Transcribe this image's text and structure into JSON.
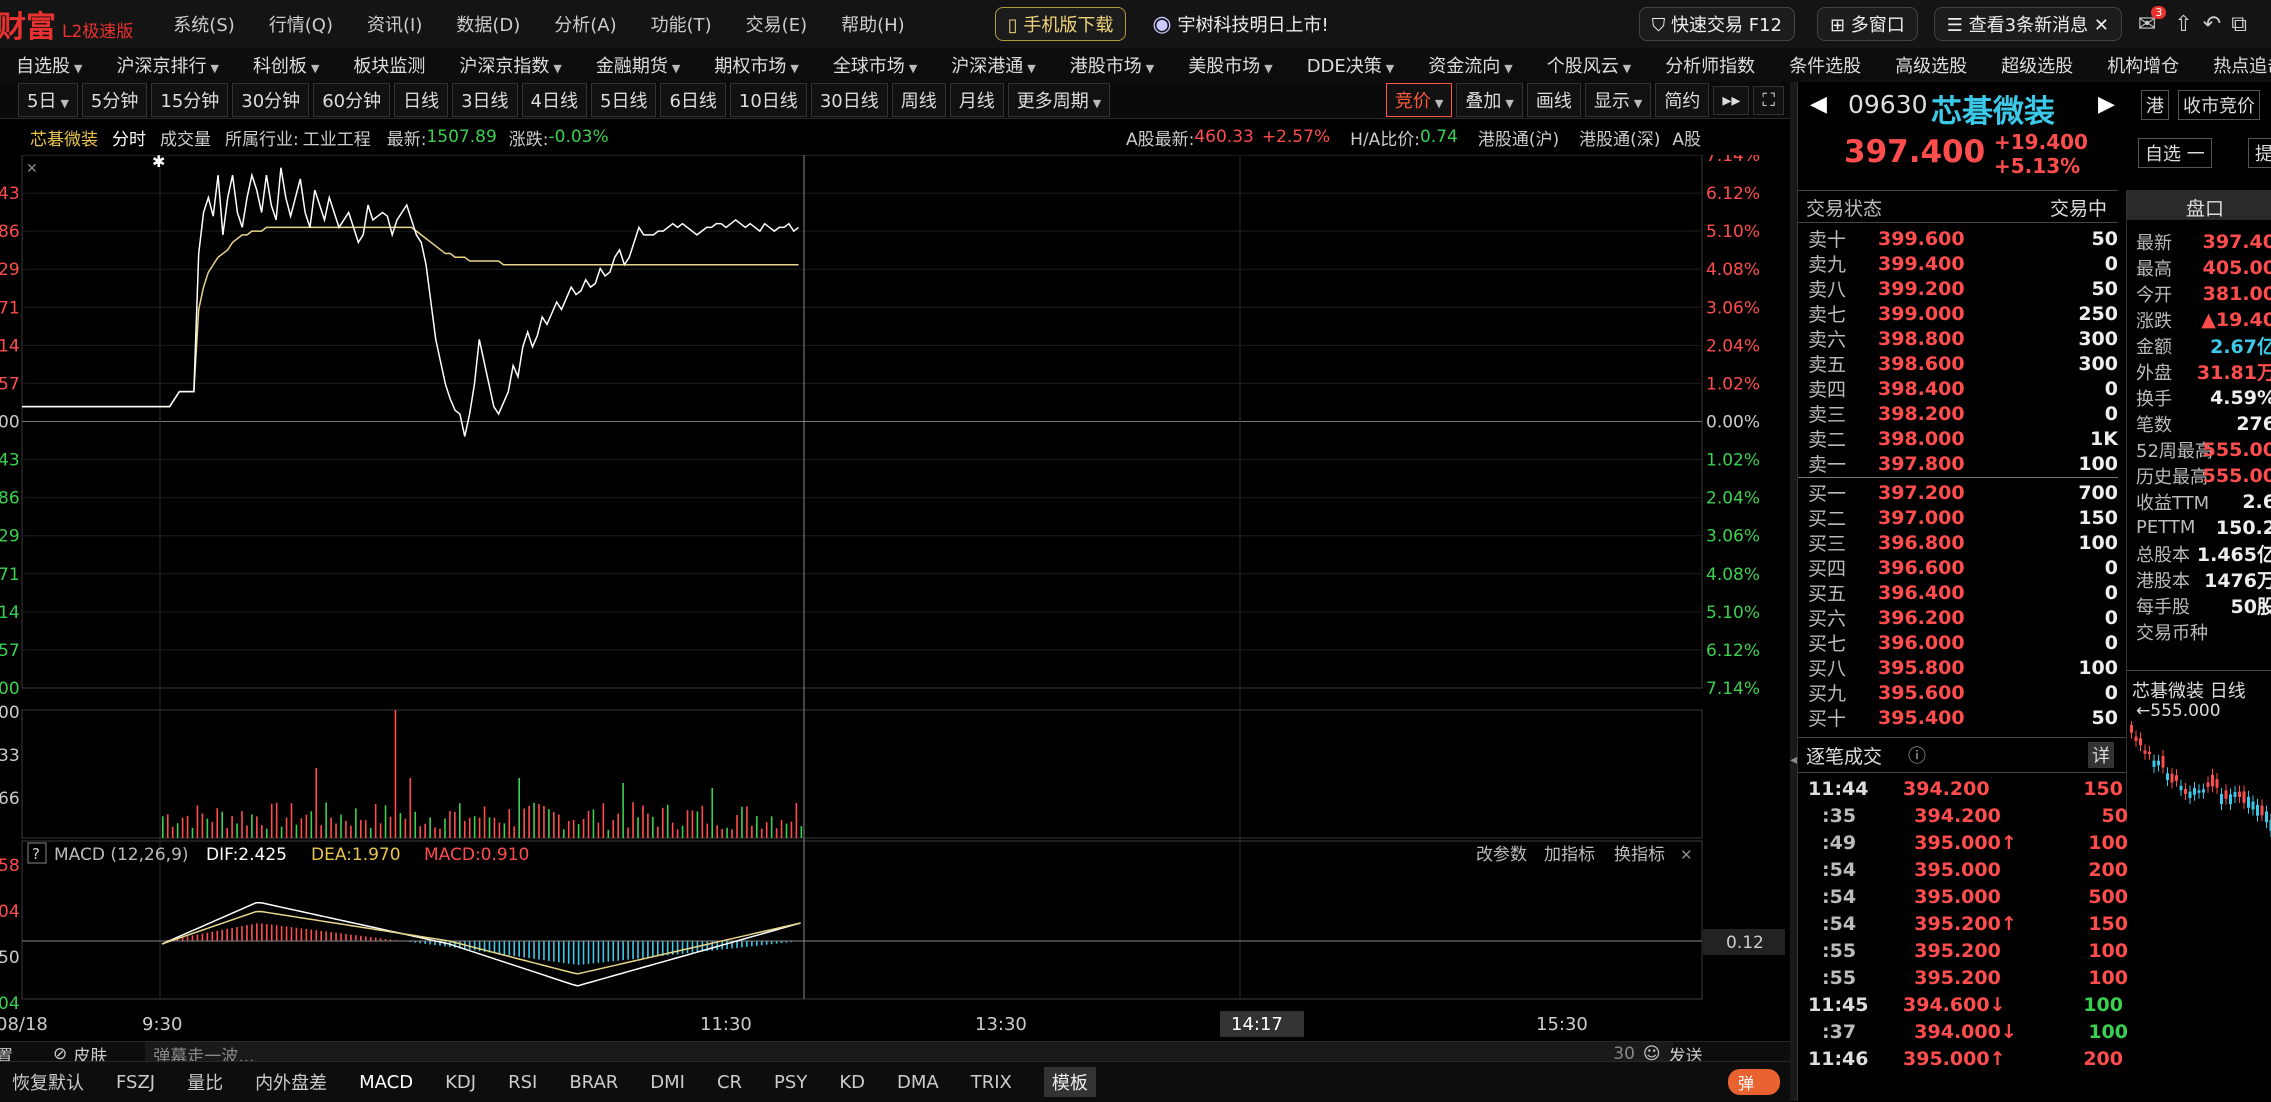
{
  "app": {
    "brand": "财富",
    "edition": "L2极速版"
  },
  "sys_menu": [
    "系统(S)",
    "行情(Q)",
    "资讯(I)",
    "数据(D)",
    "分析(A)",
    "功能(T)",
    "交易(E)",
    "帮助(H)"
  ],
  "titlebar": {
    "mobile": "手机版下载",
    "promo": "宇树科技明日上市!",
    "quick_trade": "快速交易 F12",
    "multi_window": "多窗口",
    "news": "查看3条新消息",
    "badge": "3"
  },
  "menu": [
    "自选股",
    "沪深京排行",
    "科创板",
    "板块监测",
    "沪深京指数",
    "金融期货",
    "期权市场",
    "全球市场",
    "沪深港通",
    "港股市场",
    "美股市场",
    "DDE决策",
    "资金流向",
    "个股风云",
    "分析师指数",
    "条件选股",
    "高级选股",
    "超级选股",
    "机构增仓",
    "热点追击"
  ],
  "periods": [
    "5日",
    "5分钟",
    "15分钟",
    "30分钟",
    "60分钟",
    "日线",
    "3日线",
    "4日线",
    "5日线",
    "6日线",
    "10日线",
    "30日线",
    "周线",
    "月线",
    "更多周期"
  ],
  "period_right": [
    "竞价",
    "叠加",
    "画线",
    "显示",
    "简约"
  ],
  "info": {
    "name": "芯碁微装",
    "mode": "分时",
    "vol": "成交量",
    "industry_label": "所属行业:",
    "industry": "工业工程",
    "latest_label": "最新:",
    "latest": "1507.89",
    "chg_label": "涨跌:",
    "chg": "-0.03%",
    "a_label": "A股最新:",
    "a_price": "460.33",
    "a_chg": "+2.57%",
    "ha_label": "H/A比价:",
    "ha": "0.74",
    "hk1": "港股通(沪)",
    "hk2": "港股通(深)",
    "ashare": "A股"
  },
  "chart_data": [
    {
      "type": "line",
      "name": "intraday",
      "y_left_labels": [
        "43",
        "86",
        "29",
        "71",
        "14",
        "57",
        "00",
        "43",
        "86",
        "29",
        "71",
        "14",
        "57",
        "00"
      ],
      "y_right_labels": [
        "7.14%",
        "6.12%",
        "5.10%",
        "4.08%",
        "3.06%",
        "2.04%",
        "1.02%",
        "0.00%",
        "1.02%",
        "2.04%",
        "3.06%",
        "4.08%",
        "5.10%",
        "6.12%",
        "7.14%"
      ],
      "x_labels": [
        "08/18",
        "9:30",
        "11:30",
        "13:30",
        "14:17",
        "15:30"
      ],
      "ylim": [
        -7.14,
        7.14
      ],
      "x": [
        0,
        2,
        4,
        6,
        7,
        8,
        9,
        10,
        11,
        12,
        13,
        14,
        15,
        16,
        17,
        18,
        19,
        20,
        21,
        22,
        23,
        24,
        25,
        26,
        27,
        28,
        29,
        30,
        31,
        32,
        33,
        34,
        35,
        36,
        37,
        38,
        39,
        40,
        41,
        42,
        43,
        44,
        45,
        46,
        47,
        48,
        49,
        50,
        51,
        52,
        53,
        54,
        55,
        56,
        57,
        58,
        59,
        60,
        61,
        62,
        63,
        64,
        65,
        66,
        67,
        68,
        69,
        70,
        71,
        72,
        73,
        74,
        75,
        76,
        77,
        78,
        79,
        80,
        81,
        82,
        83,
        84,
        85,
        86,
        87,
        88,
        89,
        90,
        91,
        92,
        93,
        94,
        95,
        96,
        97,
        98,
        99,
        100,
        101,
        102,
        103,
        104,
        105,
        106,
        107,
        108,
        109,
        110,
        111,
        112,
        113,
        114,
        115,
        116,
        117,
        118,
        119,
        120,
        121,
        122,
        123,
        124,
        125,
        126,
        127,
        128,
        129,
        130,
        131,
        132
      ],
      "price": [
        0.4,
        0.4,
        0.8,
        0.8,
        0.8,
        4.5,
        5.6,
        6.0,
        5.5,
        6.6,
        5.0,
        6.0,
        6.6,
        5.6,
        5.2,
        6.0,
        6.6,
        6.2,
        5.6,
        6.6,
        5.8,
        5.4,
        6.8,
        6.0,
        5.5,
        6.0,
        6.5,
        5.6,
        5.2,
        6.2,
        5.8,
        5.4,
        6.0,
        5.6,
        5.2,
        5.4,
        5.6,
        5.2,
        4.8,
        5.0,
        5.8,
        5.4,
        5.5,
        5.6,
        5.5,
        5.0,
        5.4,
        5.6,
        5.8,
        5.4,
        5.0,
        4.8,
        4.2,
        3.2,
        2.2,
        1.6,
        1.0,
        0.6,
        0.3,
        0.2,
        -0.4,
        0.2,
        1.0,
        2.2,
        1.6,
        1.0,
        0.4,
        0.2,
        0.5,
        0.8,
        1.5,
        1.2,
        2.0,
        2.4,
        2.0,
        2.3,
        2.8,
        2.6,
        2.9,
        3.2,
        3.0,
        3.3,
        3.6,
        3.4,
        3.5,
        3.8,
        3.6,
        3.7,
        4.1,
        3.9,
        4.0,
        4.4,
        4.6,
        4.2,
        4.4,
        4.8,
        5.2,
        5.0,
        5.0,
        5.0,
        5.1,
        5.1,
        5.2,
        5.3,
        5.2,
        5.3,
        5.2,
        5.1,
        5.0,
        5.1,
        5.2,
        5.2,
        5.3,
        5.3,
        5.2,
        5.3,
        5.4,
        5.3,
        5.2,
        5.3,
        5.2,
        5.1,
        5.3,
        5.2,
        5.1,
        5.2,
        5.2,
        5.3,
        5.1,
        5.2,
        5.0,
        5.2,
        5.2,
        5.1
      ],
      "avg": [
        0.4,
        0.4,
        0.8,
        0.8,
        0.8,
        3.0,
        3.6,
        4.0,
        4.2,
        4.4,
        4.5,
        4.6,
        4.8,
        4.9,
        5.0,
        5.0,
        5.1,
        5.1,
        5.1,
        5.2,
        5.2,
        5.2,
        5.2,
        5.2,
        5.2,
        5.2,
        5.2,
        5.2,
        5.2,
        5.2,
        5.2,
        5.2,
        5.2,
        5.2,
        5.2,
        5.2,
        5.2,
        5.2,
        5.2,
        5.2,
        5.2,
        5.2,
        5.2,
        5.2,
        5.2,
        5.2,
        5.2,
        5.2,
        5.2,
        5.2,
        5.1,
        5.0,
        4.9,
        4.8,
        4.7,
        4.6,
        4.5,
        4.5,
        4.4,
        4.4,
        4.4,
        4.3,
        4.3,
        4.3,
        4.3,
        4.3,
        4.3,
        4.3,
        4.2,
        4.2,
        4.2,
        4.2,
        4.2,
        4.2,
        4.2,
        4.2,
        4.2,
        4.2,
        4.2,
        4.2,
        4.2,
        4.2,
        4.2,
        4.2,
        4.2,
        4.2,
        4.2,
        4.2,
        4.2,
        4.2,
        4.2,
        4.2,
        4.2,
        4.2,
        4.2,
        4.2,
        4.2,
        4.2,
        4.2,
        4.2,
        4.2,
        4.2,
        4.2,
        4.2,
        4.2,
        4.2,
        4.2,
        4.2,
        4.2,
        4.2,
        4.2,
        4.2,
        4.2,
        4.2,
        4.2,
        4.2,
        4.2,
        4.2,
        4.2,
        4.2,
        4.2,
        4.2,
        4.2,
        4.2,
        4.2,
        4.2,
        4.2,
        4.2,
        4.2,
        4.2,
        4.2,
        4.2
      ]
    },
    {
      "type": "bar",
      "name": "volume",
      "y_left_labels": [
        "00",
        "33",
        "66"
      ]
    },
    {
      "type": "macd",
      "name": "macd",
      "title": "MACD (12,26,9)",
      "dif": "DIF:2.425",
      "dea": "DEA:1.970",
      "macd": "MACD:0.910",
      "y_left_labels": [
        "58",
        "04",
        "50",
        "04"
      ],
      "right_value": "0.12",
      "buttons": [
        "改参数",
        "加指标",
        "换指标"
      ]
    }
  ],
  "stock": {
    "code": "09630",
    "name": "芯碁微装",
    "price": "397.400",
    "chg": "+19.400",
    "pct": "+5.13%",
    "hk": "港",
    "close_price": "收市竞价",
    "watch": "自选 一",
    "ti": "提"
  },
  "trade_status": {
    "label": "交易状态",
    "value": "交易中"
  },
  "orderbook": {
    "asks": [
      [
        "卖十",
        "399.600",
        "50"
      ],
      [
        "卖九",
        "399.400",
        "0"
      ],
      [
        "卖八",
        "399.200",
        "50"
      ],
      [
        "卖七",
        "399.000",
        "250"
      ],
      [
        "卖六",
        "398.800",
        "300"
      ],
      [
        "卖五",
        "398.600",
        "300"
      ],
      [
        "卖四",
        "398.400",
        "0"
      ],
      [
        "卖三",
        "398.200",
        "0"
      ],
      [
        "卖二",
        "398.000",
        "1K"
      ],
      [
        "卖一",
        "397.800",
        "100"
      ]
    ],
    "bids": [
      [
        "买一",
        "397.200",
        "700"
      ],
      [
        "买二",
        "397.000",
        "150"
      ],
      [
        "买三",
        "396.800",
        "100"
      ],
      [
        "买四",
        "396.600",
        "0"
      ],
      [
        "买五",
        "396.400",
        "0"
      ],
      [
        "买六",
        "396.200",
        "0"
      ],
      [
        "买七",
        "396.000",
        "0"
      ],
      [
        "买八",
        "395.800",
        "100"
      ],
      [
        "买九",
        "395.600",
        "0"
      ],
      [
        "买十",
        "395.400",
        "50"
      ]
    ]
  },
  "pankou": {
    "title": "盘口",
    "rows": [
      [
        "最新",
        "397.40",
        "up"
      ],
      [
        "最高",
        "405.00",
        "up"
      ],
      [
        "今开",
        "381.00",
        "up"
      ],
      [
        "涨跌",
        "▲19.40",
        "up"
      ],
      [
        "金额",
        "2.67亿",
        "cyan"
      ],
      [
        "外盘",
        "31.81万",
        "up"
      ],
      [
        "换手",
        "4.59%",
        "white"
      ],
      [
        "笔数",
        "276",
        "white"
      ],
      [
        "52周最高",
        "555.00",
        "up"
      ],
      [
        "历史最高",
        "555.00",
        "up"
      ],
      [
        "收益TTM",
        "2.6",
        "white"
      ],
      [
        "PETTM",
        "150.2",
        "white"
      ],
      [
        "总股本",
        "1.465亿",
        "white"
      ],
      [
        "港股本",
        "1476万",
        "white"
      ],
      [
        "每手股",
        "50股",
        "white"
      ],
      [
        "交易币种",
        "",
        "white"
      ]
    ]
  },
  "mini": {
    "title": "芯碁微装 日线",
    "high": "555.000"
  },
  "ticks": {
    "title": "逐笔成交",
    "detail": "详",
    "rows": [
      [
        "11:44",
        "394.200",
        "150",
        "",
        ""
      ],
      [
        ":35",
        "394.200",
        "50",
        "",
        ""
      ],
      [
        ":49",
        "395.000",
        "100",
        "↑",
        ""
      ],
      [
        ":54",
        "395.000",
        "200",
        "",
        ""
      ],
      [
        ":54",
        "395.000",
        "500",
        "",
        ""
      ],
      [
        ":54",
        "395.200",
        "150",
        "↑",
        ""
      ],
      [
        ":55",
        "395.200",
        "100",
        "",
        ""
      ],
      [
        ":55",
        "395.200",
        "100",
        "",
        ""
      ],
      [
        "11:45",
        "394.600",
        "100",
        "↓",
        "g"
      ],
      [
        ":37",
        "394.000",
        "100",
        "↓",
        "g"
      ],
      [
        "11:46",
        "395.000",
        "200",
        "↑",
        ""
      ]
    ]
  },
  "danmu": {
    "settings": "置",
    "skin": "皮肤",
    "placeholder": "弹幕走一波...",
    "count": "30",
    "send": "发送"
  },
  "bottom": {
    "indicators": [
      "恢复默认",
      "FSZJ",
      "量比",
      "内外盘差",
      "MACD",
      "KDJ",
      "RSI",
      "BRAR",
      "DMI",
      "CR",
      "PSY",
      "KD",
      "DMA",
      "TRIX"
    ],
    "template": "模板",
    "toggle": "弹"
  }
}
